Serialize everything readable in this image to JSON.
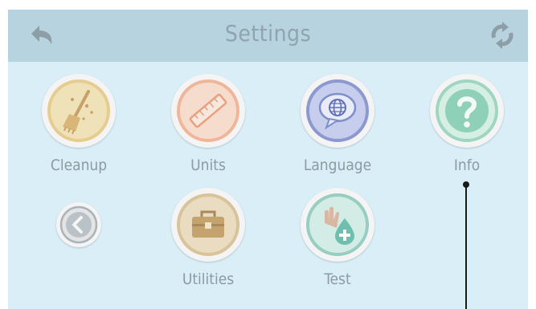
{
  "header": {
    "title": "Settings",
    "back_icon": "back-arrow-icon",
    "refresh_icon": "refresh-icon"
  },
  "tiles": [
    {
      "label": "Cleanup",
      "icon": "broom-icon"
    },
    {
      "label": "Units",
      "icon": "ruler-icon"
    },
    {
      "label": "Language",
      "icon": "globe-speech-icon"
    },
    {
      "label": "Info",
      "icon": "question-icon"
    },
    {
      "label": "",
      "icon": "chevron-left-icon"
    },
    {
      "label": "Utilities",
      "icon": "toolbox-icon"
    },
    {
      "label": "Test",
      "icon": "hand-sanitizer-icon"
    }
  ],
  "colors": {
    "background": "#daeef7",
    "header": "#b6d3df",
    "title_text": "#8fa4ae",
    "label_text": "#8c9aa2",
    "cleanup_ring": "#e6cc8f",
    "units_ring": "#f0b69a",
    "language_ring": "#8b99cf",
    "info_ring": "#9fd6c1",
    "utilities_ring": "#d8c39b",
    "test_ring": "#98cdc1"
  }
}
